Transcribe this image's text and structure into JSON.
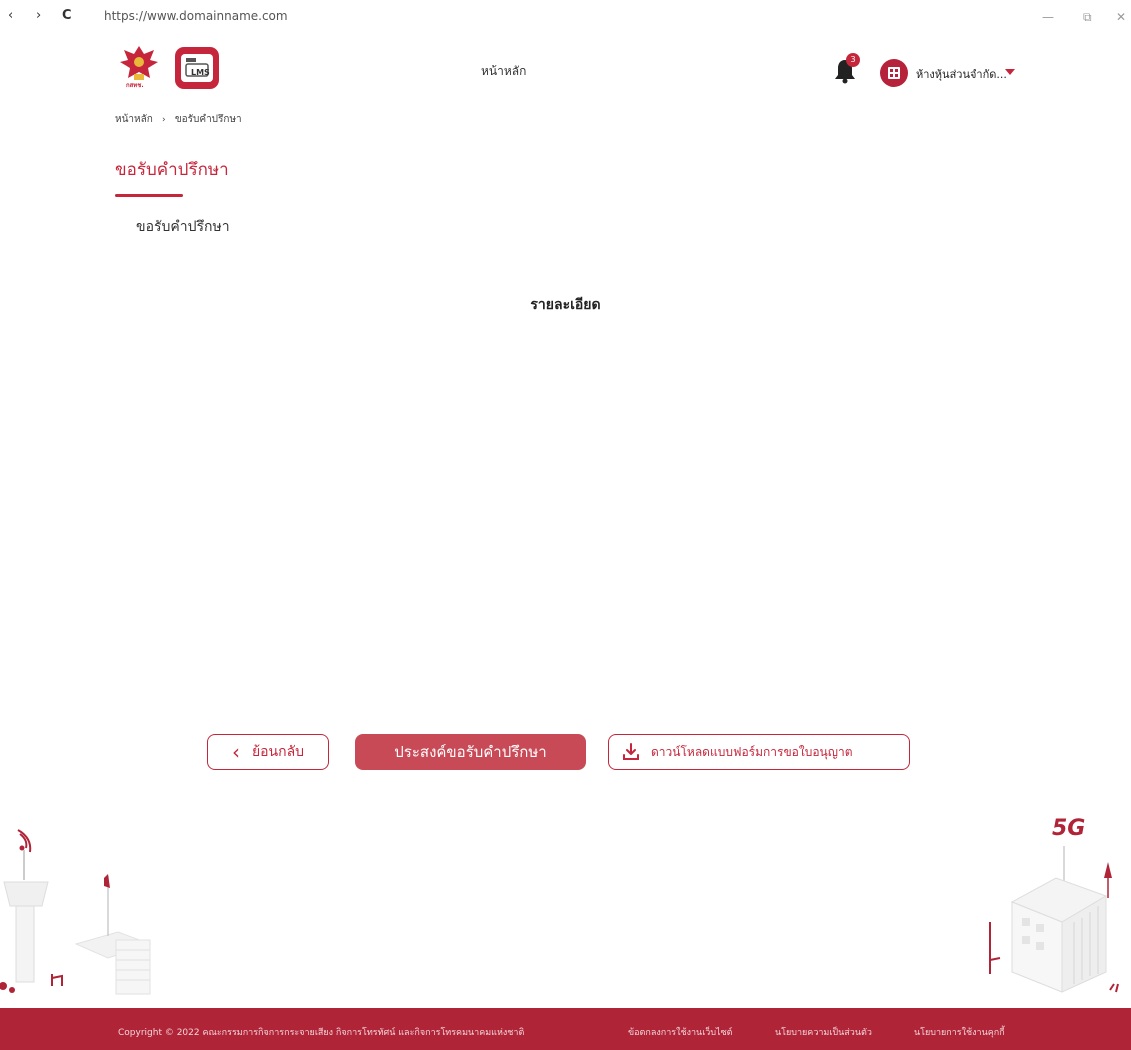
{
  "browser": {
    "back": "‹",
    "forward": "›",
    "reload": "C",
    "url": "https://www.domainname.com",
    "minimize": "—",
    "restore": "⧉",
    "close": "✕"
  },
  "header": {
    "logo1_text": "กสทช.",
    "logo2_text": "LMS",
    "nav_home": "หน้าหลัก",
    "notification_count": "3",
    "user_name": "ห้างหุ้นส่วนจำกัด..."
  },
  "breadcrumb": {
    "home": "หน้าหลัก",
    "separator": "›",
    "current": "ขอรับคำปรึกษา"
  },
  "page": {
    "title": "ขอรับคำปรึกษา",
    "subtitle": "ขอรับคำปรึกษา",
    "details_heading": "รายละเอียด"
  },
  "buttons": {
    "back_label": "ย้อนกลับ",
    "request_label": "ประสงค์ขอรับคำปรึกษา",
    "download_label": "ดาวน์โหลดแบบฟอร์มการขอใบอนุญาต"
  },
  "illustration": {
    "label_5g": "5G"
  },
  "footer": {
    "copyright": "Copyright © 2022 คณะกรรมการกิจการกระจายเสียง กิจการโทรทัศน์ และกิจการโทรคมนาคมแห่งชาติ",
    "terms": "ข้อตกลงการใช้งานเว็บไซต์",
    "privacy": "นโยบายความเป็นส่วนตัว",
    "cookies": "นโยบายการใช้งานคุกกี้"
  },
  "colors": {
    "brand": "#c6263b",
    "footer_bg": "#b02438",
    "primary_button": "#c94a57"
  }
}
